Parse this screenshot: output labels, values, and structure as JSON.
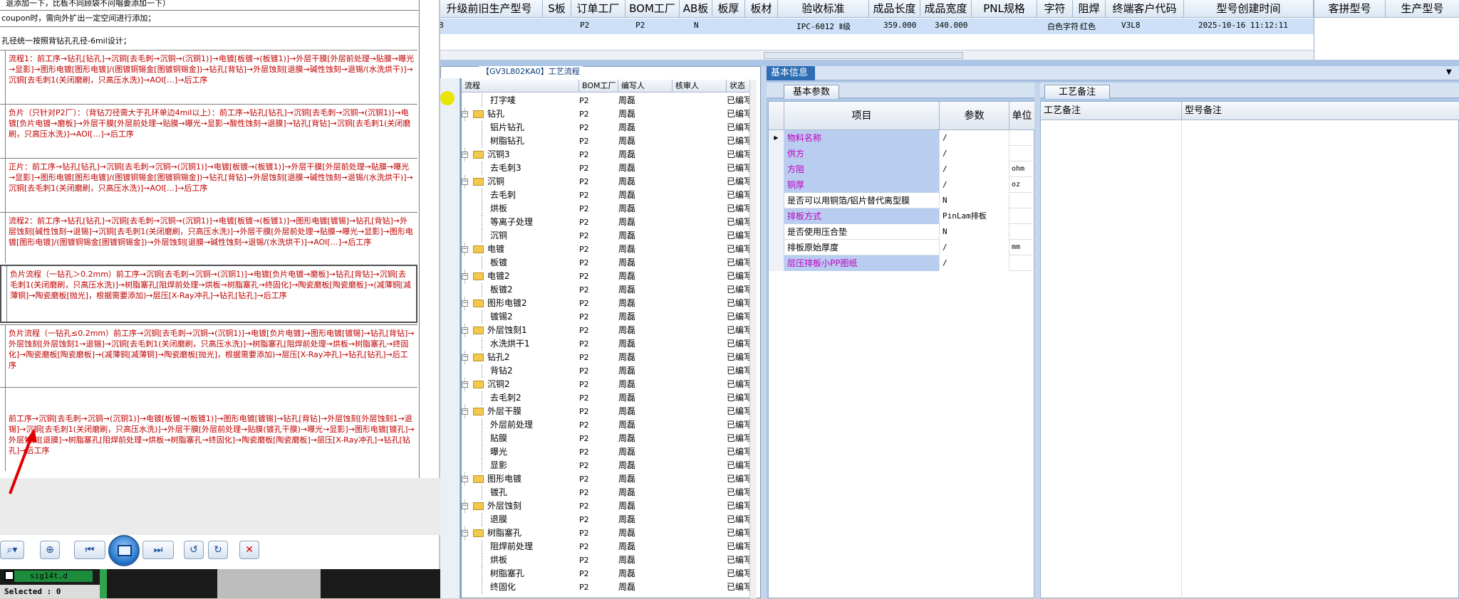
{
  "top_grid": {
    "headers": [
      "升级前旧生产型号",
      "S板",
      "订单工厂",
      "BOM工厂",
      "AB板",
      "板厚",
      "板材",
      "验收标准",
      "成品长度",
      "成品宽度",
      "PNL规格",
      "字符",
      "阻焊",
      "终端客户代码",
      "型号创建时间"
    ],
    "row": {
      "first": "8",
      "order_factory": "P2",
      "bom_factory": "P2",
      "ab": "N",
      "standard": "IPC-6012 Ⅱ级",
      "length": "359.000",
      "width": "340.000",
      "char": "白色字符",
      "mask": "红色",
      "customer": "V3L8",
      "created": "2025-10-16 11:12:11"
    },
    "far_right_headers": [
      "客拼型号",
      "生产型号"
    ]
  },
  "doc": {
    "lines": [
      "退添加一下，比板不同顾袋不问唱要添加一下）",
      "coupon时，需向外扩出一定空间进行添加；",
      "孔径统一按照背钻孔孔径-6mil设计；"
    ],
    "boxes": [
      "流程1：前工序→钻孔[钻孔]→沉铜[去毛刺→沉铜→(沉铜1)]→电镀[板镀→(板镀1)]→外层干膜[外层前处理→贴膜→曝光→显影]→图形电镀[图形电镀]/(图镀铜锡金[图镀铜锡金])→钻孔[背钻]→外层蚀刻[退膜→碱性蚀刻→退锡/(水洗烘干)]→沉铜[去毛刺1(关闭磨刷，只高压水洗)]→AOI[…]→后工序",
      "负片（只针对P2厂）：（背钻刀径需大于孔环单边4mil以上）：前工序→钻孔[钻孔]→沉铜[去毛刺→沉铜→(沉铜1)]→电镀[负片电镀→磨板]→外层干膜[外层前处理→贴膜→曝光→显影→酸性蚀刻→退膜]→钻孔[背钻]→沉铜[去毛刺1(关闭磨刷，只高压水洗)]→AOI[…]→后工序",
      "正片：前工序→钻孔[钻孔]→沉铜[去毛刺→沉铜→(沉铜1)]→电镀[板镀→(板镀1)]→外层干膜[外层前处理→贴膜→曝光→显影]→图形电镀[图形电镀]/(图镀铜锡金[图镀铜锡金])→钻孔[背钻]→外层蚀刻[退膜→碱性蚀刻→退锡/(水洗烘干)]→沉铜[去毛刺1(关闭磨刷，只高压水洗)]→AOI[…]→后工序",
      "流程2：前工序→钻孔[钻孔]→沉铜[去毛刺→沉铜→(沉铜1)]→电镀[板镀→(板镀1)]→图形电镀[镀锡]→钻孔[背钻]→外层蚀刻[碱性蚀刻→退锡]→沉铜[去毛刺1(关闭磨刷，只高压水洗)]→外层干膜[外层前处理→贴膜→曝光→显影]→图形电镀[图形电镀]/(图镀铜锡金[图镀铜锡金])→外层蚀刻[退膜→碱性蚀刻→退锡/(水洗烘干)]→AOI[…]→后工序",
      "负片流程（一钻孔＞0.2mm）前工序→沉铜[去毛刺→沉铜→(沉铜1)]→电镀[负片电镀→磨板]→钻孔[背钻]→沉铜[去毛刺1(关闭磨刷，只高压水洗)]→树脂塞孔[阻焊前处理→烘板→树脂塞孔→终固化]→陶瓷磨板[陶瓷磨板]→(减薄铜[减薄铜]→陶瓷磨板[抛光]，根据需要添加)→层压[X-Ray冲孔]→钻孔[钻孔]→后工序",
      "负片流程（一钻孔≤0.2mm）前工序→沉铜[去毛刺→沉铜→(沉铜1)]→电镀[负片电镀]→图形电镀[镀锡]→钻孔[背钻]→外层蚀刻[外层蚀刻1→退锡]→沉铜[去毛刺1(关闭磨刷，只高压水洗)]→树脂塞孔[阻焊前处理→烘板→树脂塞孔→终固化]→陶瓷磨板[陶瓷磨板]→(减薄铜[减薄铜]→陶瓷磨板[抛光]，根据需要添加)→层压[X-Ray冲孔]→钻孔[钻孔]→后工序",
      "前工序→沉铜[去毛刺→沉铜→(沉铜1)]→电镀[板镀→(板镀1)]→图形电镀[镀锡]→钻孔[背钻]→外层蚀刻[外层蚀刻1→退锡]→沉铜[去毛刺1(关闭磨刷，只高压水洗)]→外层干膜[外层前处理→贴膜(镀孔干膜)→曝光→显影]→图形电镀[镀孔]→外层蚀刻[退膜]→树脂塞孔[阻焊前处理→烘板→树脂塞孔→终固化]→陶瓷磨板[陶瓷磨板]→层压[X-Ray冲孔]→钻孔[钻孔]→后工序"
    ]
  },
  "desktop": {
    "sig_file": "sig14t.d",
    "selected": "Selected : 0"
  },
  "process_tree": {
    "title": "【GV3L802KA0】工艺流程",
    "headers": [
      "流程",
      "BOM工厂",
      "编写人",
      "核审人",
      "状态"
    ],
    "rows": [
      {
        "name": "打字唛",
        "level": 2,
        "folder": false,
        "bom": "P2",
        "author": "周磊",
        "status": "已编写"
      },
      {
        "name": "钻孔",
        "level": 1,
        "folder": true,
        "bom": "P2",
        "author": "周磊",
        "status": "已编写"
      },
      {
        "name": "铝片钻孔",
        "level": 2,
        "folder": false,
        "bom": "P2",
        "author": "周磊",
        "status": "已编写"
      },
      {
        "name": "树脂钻孔",
        "level": 2,
        "folder": false,
        "bom": "P2",
        "author": "周磊",
        "status": "已编写"
      },
      {
        "name": "沉铜3",
        "level": 1,
        "folder": true,
        "bom": "P2",
        "author": "周磊",
        "status": "已编写"
      },
      {
        "name": "去毛刺3",
        "level": 2,
        "folder": false,
        "bom": "P2",
        "author": "周磊",
        "status": "已编写"
      },
      {
        "name": "沉铜",
        "level": 1,
        "folder": true,
        "bom": "P2",
        "author": "周磊",
        "status": "已编写"
      },
      {
        "name": "去毛刺",
        "level": 2,
        "folder": false,
        "bom": "P2",
        "author": "周磊",
        "status": "已编写"
      },
      {
        "name": "烘板",
        "level": 2,
        "folder": false,
        "bom": "P2",
        "author": "周磊",
        "status": "已编写"
      },
      {
        "name": "等离子处理",
        "level": 2,
        "folder": false,
        "bom": "P2",
        "author": "周磊",
        "status": "已编写"
      },
      {
        "name": "沉铜",
        "level": 2,
        "folder": false,
        "bom": "P2",
        "author": "周磊",
        "status": "已编写"
      },
      {
        "name": "电镀",
        "level": 1,
        "folder": true,
        "bom": "P2",
        "author": "周磊",
        "status": "已编写"
      },
      {
        "name": "板镀",
        "level": 2,
        "folder": false,
        "bom": "P2",
        "author": "周磊",
        "status": "已编写"
      },
      {
        "name": "电镀2",
        "level": 1,
        "folder": true,
        "bom": "P2",
        "author": "周磊",
        "status": "已编写"
      },
      {
        "name": "板镀2",
        "level": 2,
        "folder": false,
        "bom": "P2",
        "author": "周磊",
        "status": "已编写"
      },
      {
        "name": "图形电镀2",
        "level": 1,
        "folder": true,
        "bom": "P2",
        "author": "周磊",
        "status": "已编写"
      },
      {
        "name": "镀锡2",
        "level": 2,
        "folder": false,
        "bom": "P2",
        "author": "周磊",
        "status": "已编写"
      },
      {
        "name": "外层蚀刻1",
        "level": 1,
        "folder": true,
        "bom": "P2",
        "author": "周磊",
        "status": "已编写"
      },
      {
        "name": "水洗烘干1",
        "level": 2,
        "folder": false,
        "bom": "P2",
        "author": "周磊",
        "status": "已编写"
      },
      {
        "name": "钻孔2",
        "level": 1,
        "folder": true,
        "bom": "P2",
        "author": "周磊",
        "status": "已编写"
      },
      {
        "name": "背钻2",
        "level": 2,
        "folder": false,
        "bom": "P2",
        "author": "周磊",
        "status": "已编写"
      },
      {
        "name": "沉铜2",
        "level": 1,
        "folder": true,
        "bom": "P2",
        "author": "周磊",
        "status": "已编写"
      },
      {
        "name": "去毛刺2",
        "level": 2,
        "folder": false,
        "bom": "P2",
        "author": "周磊",
        "status": "已编写"
      },
      {
        "name": "外层干膜",
        "level": 1,
        "folder": true,
        "bom": "P2",
        "author": "周磊",
        "status": "已编写"
      },
      {
        "name": "外层前处理",
        "level": 2,
        "folder": false,
        "bom": "P2",
        "author": "周磊",
        "status": "已编写"
      },
      {
        "name": "贴膜",
        "level": 2,
        "folder": false,
        "bom": "P2",
        "author": "周磊",
        "status": "已编写"
      },
      {
        "name": "曝光",
        "level": 2,
        "folder": false,
        "bom": "P2",
        "author": "周磊",
        "status": "已编写"
      },
      {
        "name": "显影",
        "level": 2,
        "folder": false,
        "bom": "P2",
        "author": "周磊",
        "status": "已编写"
      },
      {
        "name": "图形电镀",
        "level": 1,
        "folder": true,
        "bom": "P2",
        "author": "周磊",
        "status": "已编写"
      },
      {
        "name": "镀孔",
        "level": 2,
        "folder": false,
        "bom": "P2",
        "author": "周磊",
        "status": "已编写"
      },
      {
        "name": "外层蚀刻",
        "level": 1,
        "folder": true,
        "bom": "P2",
        "author": "周磊",
        "status": "已编写"
      },
      {
        "name": "退膜",
        "level": 2,
        "folder": false,
        "bom": "P2",
        "author": "周磊",
        "status": "已编写"
      },
      {
        "name": "树脂塞孔",
        "level": 1,
        "folder": true,
        "bom": "P2",
        "author": "周磊",
        "status": "已编写"
      },
      {
        "name": "阻焊前处理",
        "level": 2,
        "folder": false,
        "bom": "P2",
        "author": "周磊",
        "status": "已编写"
      },
      {
        "name": "烘板",
        "level": 2,
        "folder": false,
        "bom": "P2",
        "author": "周磊",
        "status": "已编写"
      },
      {
        "name": "树脂塞孔",
        "level": 2,
        "folder": false,
        "bom": "P2",
        "author": "周磊",
        "status": "已编写"
      },
      {
        "name": "终固化",
        "level": 2,
        "folder": false,
        "bom": "P2",
        "author": "周磊",
        "status": "已编写"
      }
    ]
  },
  "basic_info": {
    "tab": "基本信息",
    "sub_tab": "基本参数",
    "headers": [
      "项目",
      "参数",
      "单位"
    ],
    "rows": [
      {
        "item": "物料名称",
        "value": "/",
        "unit": "",
        "magenta": true,
        "highlight": true
      },
      {
        "item": "供方",
        "value": "/",
        "unit": "",
        "magenta": true,
        "highlight": true
      },
      {
        "item": "方阻",
        "value": "/",
        "unit": "ohm",
        "magenta": true,
        "highlight": true
      },
      {
        "item": "铜厚",
        "value": "/",
        "unit": "oz",
        "magenta": true,
        "highlight": true
      },
      {
        "item": "是否可以用铜箔/铝片替代离型膜",
        "value": "N",
        "unit": "",
        "magenta": false,
        "highlight": false
      },
      {
        "item": "排板方式",
        "value": "PinLam排板",
        "unit": "",
        "magenta": true,
        "highlight": true
      },
      {
        "item": "是否使用压合垫",
        "value": "N",
        "unit": "",
        "magenta": false,
        "highlight": false
      },
      {
        "item": "排板原始厚度",
        "value": "/",
        "unit": "mm",
        "magenta": false,
        "highlight": false
      },
      {
        "item": "层压排板小PP图纸",
        "value": "/",
        "unit": "",
        "magenta": true,
        "highlight": true
      }
    ]
  },
  "process_notes": {
    "tab": "工艺备注",
    "headers": [
      "工艺备注",
      "型号备注"
    ]
  },
  "colors": {
    "magenta": "#c000c0",
    "doc_red": "#c00000",
    "accent": "#2e6db4"
  }
}
